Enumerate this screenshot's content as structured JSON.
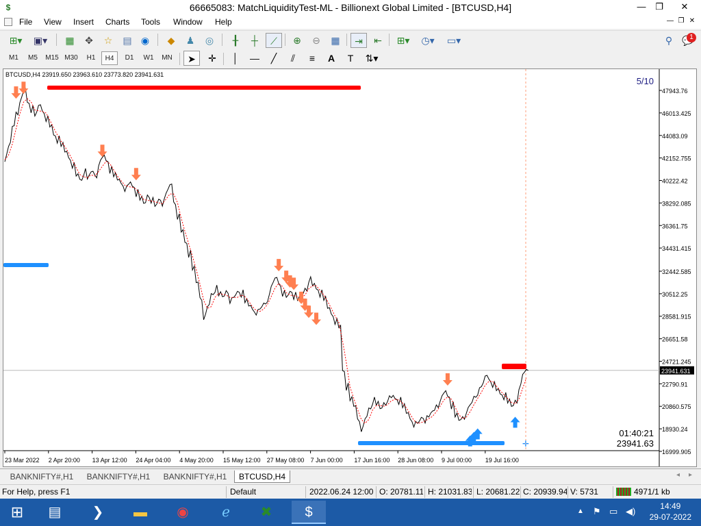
{
  "window": {
    "title": "66665083: MatchLiquidityTest-ML - Billionext Global Limited - [BTCUSD,H4]",
    "minimize": "—",
    "maximize": "❐",
    "close": "✕"
  },
  "menu": [
    "File",
    "View",
    "Insert",
    "Charts",
    "Tools",
    "Window",
    "Help"
  ],
  "notification_count": "1",
  "timeframes": [
    "M1",
    "M5",
    "M15",
    "M30",
    "H1",
    "H4",
    "D1",
    "W1",
    "MN"
  ],
  "active_timeframe": "H4",
  "chart": {
    "symbol_info": "BTCUSD,H4  23919.650 23963.610 23773.820 23941.631",
    "counter": "5/10",
    "timer": "01:40:21",
    "price_readout": "23941.63",
    "current_price_label": "23941.631"
  },
  "chart_data": {
    "type": "line",
    "series": [
      {
        "values": [
          42000,
          43200,
          44800,
          45900,
          47000,
          47900,
          46800,
          46200,
          45800,
          46600,
          46000,
          45400,
          44800,
          44000,
          43600,
          43200,
          42600,
          42000,
          41400,
          40600,
          40200,
          40800,
          40400,
          40900,
          40500,
          41600,
          42200,
          41800,
          41000,
          40600,
          40200,
          39800,
          39400,
          39900,
          39600,
          39000,
          38600,
          38200,
          38800,
          38400,
          38000,
          38500,
          38200,
          39200,
          39800,
          38200,
          37000,
          35800,
          34800,
          33800,
          32600,
          31400,
          30000,
          28400,
          29400,
          30400,
          30800,
          30400,
          30200,
          30600,
          29800,
          30200,
          30600,
          30400,
          29800,
          29400,
          29000,
          28800,
          29200,
          29600,
          30000,
          31200,
          31800,
          31200,
          30400,
          30200,
          30600,
          30200,
          30000,
          30400,
          30800,
          31600,
          31200,
          30800,
          30400,
          30000,
          29200,
          28600,
          28000,
          27600,
          23800,
          22400,
          21400,
          20800,
          19600,
          18800,
          19800,
          20600,
          21200,
          21000,
          20600,
          21000,
          21400,
          21600,
          21400,
          21200,
          20800,
          20200,
          19600,
          19200,
          19400,
          19800,
          19600,
          20000,
          20400,
          20800,
          21400,
          22000,
          21600,
          20800,
          20000,
          19600,
          19800,
          20400,
          21000,
          21600,
          22000,
          22600,
          23400,
          23000,
          22600,
          22200,
          21800,
          21600,
          21200,
          20800,
          21200,
          22400,
          23600,
          23900
        ]
      }
    ],
    "x_labels": [
      "23 Mar 2022",
      "2 Apr 20:00",
      "13 Apr 12:00",
      "24 Apr 04:00",
      "4 May 20:00",
      "15 May 12:00",
      "27 May 08:00",
      "7 Jun 00:00",
      "17 Jun 16:00",
      "28 Jun 08:00",
      "9 Jul 00:00",
      "19 Jul 16:00"
    ],
    "y_ticks": [
      47943.76,
      46013.425,
      44083.09,
      42152.755,
      40222.42,
      38292.085,
      36361.75,
      34431.415,
      32442.585,
      30512.25,
      28581.915,
      26651.58,
      24721.245,
      22790.91,
      20860.575,
      18930.24,
      16999.905
    ],
    "ylim": [
      16999.905,
      49000
    ],
    "sell_arrows": [
      [
        3,
        47000
      ],
      [
        5,
        47400
      ],
      [
        26,
        42000
      ],
      [
        35,
        40000
      ],
      [
        73,
        32200
      ],
      [
        75,
        31200
      ],
      [
        76,
        30800
      ],
      [
        77,
        30600
      ],
      [
        79,
        29400
      ],
      [
        80,
        28800
      ],
      [
        81,
        28200
      ],
      [
        83,
        27600
      ],
      [
        118,
        22400
      ]
    ],
    "buy_arrows": [
      [
        124,
        18600
      ],
      [
        125,
        18900
      ],
      [
        126,
        19200
      ],
      [
        136,
        20200
      ]
    ]
  },
  "tabs": [
    "BANKNIFTY#,H1",
    "BANKNIFTY#,H1",
    "BANKNIFTY#,H1",
    "BTCUSD,H4"
  ],
  "active_tab": "BTCUSD,H4",
  "status": {
    "help": "For Help, press F1",
    "profile": "Default",
    "datetime": "2022.06.24 12:00",
    "open": "O: 20781.110",
    "high": "H: 21031.830",
    "low": "L: 20681.220",
    "close": "C: 20939.940",
    "volume": "V: 5731",
    "traffic": "4971/1 kb"
  },
  "taskbar": {
    "time": "14:49",
    "date": "29-07-2022"
  },
  "colors": {
    "sell": "#ff7f50",
    "buy": "#1e90ff",
    "red_bar": "#ff0000",
    "price": "#000000",
    "ma": "#ff0000"
  }
}
